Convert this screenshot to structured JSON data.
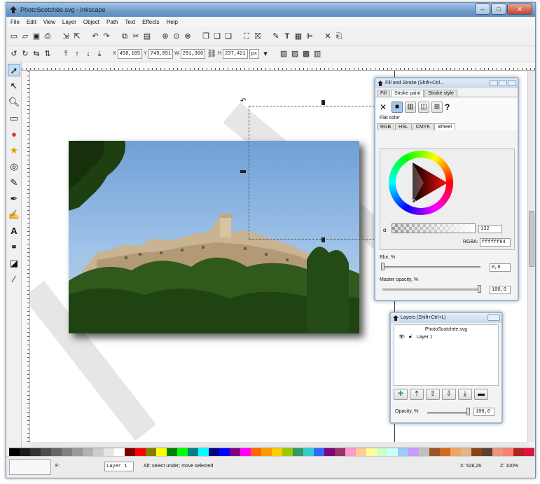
{
  "window": {
    "title": "PhotoScotchée.svg - Inkscape",
    "buttons": {
      "minimize": "–",
      "maximize": "□",
      "close": "✕"
    }
  },
  "menu": [
    "File",
    "Edit",
    "View",
    "Layer",
    "Object",
    "Path",
    "Text",
    "Effects",
    "Help"
  ],
  "toolbar2": {
    "x_label": "X",
    "x_value": "458,105",
    "y_label": "Y",
    "y_value": "749,051",
    "w_label": "W",
    "w_value": "291,360",
    "h_label": "H",
    "h_value": "237,421",
    "unit": "px"
  },
  "fill_stroke": {
    "title": "Fill and Stroke (Shift+Ctrl...",
    "tabs": [
      "Fill",
      "Stroke paint",
      "Stroke style"
    ],
    "selected_tab": "Stroke paint",
    "paint_unset": "?",
    "flat_color_label": "Flat color",
    "color_tabs": [
      "RGB",
      "HSL",
      "CMYK",
      "Wheel"
    ],
    "selected_color_tab": "Wheel",
    "alpha_value": "132",
    "rgba_label": "RGBA:",
    "rgba_value": "ffffff84",
    "blur_label": "Blur, %",
    "blur_value": "0,0",
    "opacity_label": "Master opacity, %",
    "opacity_value": "100,0"
  },
  "layers": {
    "title": "Layers (Shift+Ctrl+L)",
    "document": "PhotoScotchée.svg",
    "items": [
      {
        "name": "Layer 1"
      }
    ],
    "opacity_label": "Opacity, %",
    "opacity_value": "100,0"
  },
  "status": {
    "fill_label": "F:",
    "layer": "Layer 1",
    "message": "Alt: select under; move selected",
    "cursor": "X: 528,26",
    "zoom": "Z: 100%"
  },
  "colors": {
    "accent": "#6f9bc8",
    "palette": [
      "#000000",
      "#1a1a1a",
      "#333333",
      "#4d4d4d",
      "#666666",
      "#808080",
      "#999999",
      "#b3b3b3",
      "#cccccc",
      "#e6e6e6",
      "#ffffff",
      "#800000",
      "#ff0000",
      "#808000",
      "#ffff00",
      "#008000",
      "#00ff00",
      "#008080",
      "#00ffff",
      "#000080",
      "#0000ff",
      "#800080",
      "#ff00ff",
      "#ff6600",
      "#ff9900",
      "#ffcc00",
      "#99cc00",
      "#339966",
      "#33cccc",
      "#3366ff",
      "#800080",
      "#993366",
      "#ff99cc",
      "#ffcc99",
      "#ffff99",
      "#ccffcc",
      "#ccffff",
      "#99ccff",
      "#cc99ff",
      "#c0c0c0",
      "#a0522d",
      "#d2691e",
      "#f4a460",
      "#deb887",
      "#8b4513",
      "#5c4033",
      "#e9967a",
      "#fa8072",
      "#b22222",
      "#dc143c"
    ]
  }
}
